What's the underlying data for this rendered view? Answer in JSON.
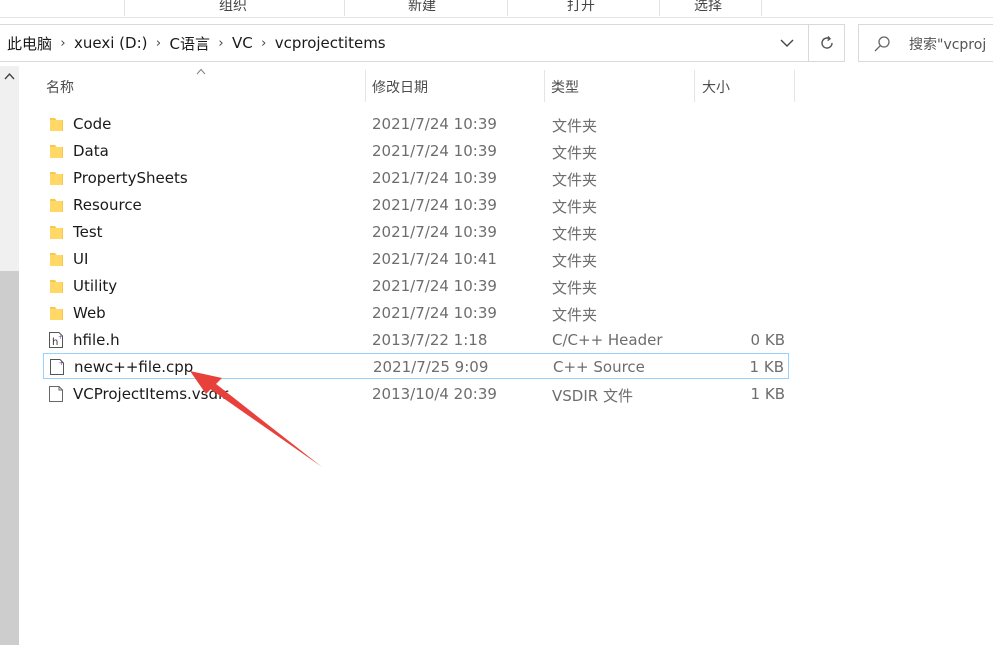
{
  "ribbon": {
    "groups": [
      "组织",
      "新建",
      "打开",
      "选择"
    ]
  },
  "address": {
    "crumbs": [
      "此电脑",
      "xuexi (D:)",
      "C语言",
      "VC",
      "vcprojectitems"
    ]
  },
  "search": {
    "placeholder": "搜索\"vcproj"
  },
  "columns": {
    "name": "名称",
    "date": "修改日期",
    "type": "类型",
    "size": "大小"
  },
  "files": [
    {
      "name": "Code",
      "date": "2021/7/24 10:39",
      "type": "文件夹",
      "size": "",
      "icon": "folder-icon"
    },
    {
      "name": "Data",
      "date": "2021/7/24 10:39",
      "type": "文件夹",
      "size": "",
      "icon": "folder-icon"
    },
    {
      "name": "PropertySheets",
      "date": "2021/7/24 10:39",
      "type": "文件夹",
      "size": "",
      "icon": "folder-icon"
    },
    {
      "name": "Resource",
      "date": "2021/7/24 10:39",
      "type": "文件夹",
      "size": "",
      "icon": "folder-icon"
    },
    {
      "name": "Test",
      "date": "2021/7/24 10:39",
      "type": "文件夹",
      "size": "",
      "icon": "folder-icon"
    },
    {
      "name": "UI",
      "date": "2021/7/24 10:41",
      "type": "文件夹",
      "size": "",
      "icon": "folder-icon"
    },
    {
      "name": "Utility",
      "date": "2021/7/24 10:39",
      "type": "文件夹",
      "size": "",
      "icon": "folder-icon"
    },
    {
      "name": "Web",
      "date": "2021/7/24 10:39",
      "type": "文件夹",
      "size": "",
      "icon": "folder-icon"
    },
    {
      "name": "hfile.h",
      "date": "2013/7/22 1:18",
      "type": "C/C++ Header",
      "size": "0 KB",
      "icon": "header-file-icon"
    },
    {
      "name": "newc++file.cpp",
      "date": "2021/7/25 9:09",
      "type": "C++ Source",
      "size": "1 KB",
      "icon": "cpp-file-icon"
    },
    {
      "name": "VCProjectItems.vsdir",
      "date": "2013/10/4 20:39",
      "type": "VSDIR 文件",
      "size": "1 KB",
      "icon": "generic-file-icon"
    }
  ],
  "colors": {
    "selection_border": "#99d1ff",
    "folder": "#f8c74e",
    "annotation_arrow": "#e8413b"
  }
}
